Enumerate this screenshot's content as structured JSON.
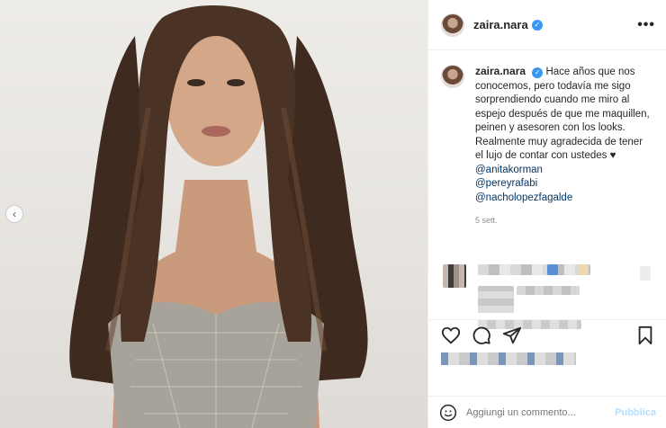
{
  "post": {
    "username": "zaira.nara",
    "verified_icon": "verified-badge-icon",
    "more_label": "•••",
    "caption_text": "Hace años que nos conocemos, pero todavía me sigo sorprendiendo cuando me miro al espejo después de que me maquillen, peinen y asesoren con los looks. Realmente muy agradecida de tener el lujo de contar con ustedes ♥",
    "mentions": [
      "@anitakorman",
      "@pereyrafabi",
      "@nacholopezfagalde"
    ],
    "timestamp": "5 sett."
  },
  "composer": {
    "placeholder": "Aggiungi un commento...",
    "publish_label": "Pubblica"
  },
  "colors": {
    "accent": "#3897f0",
    "mention": "#00376b",
    "publish_disabled": "#b2dffc"
  }
}
